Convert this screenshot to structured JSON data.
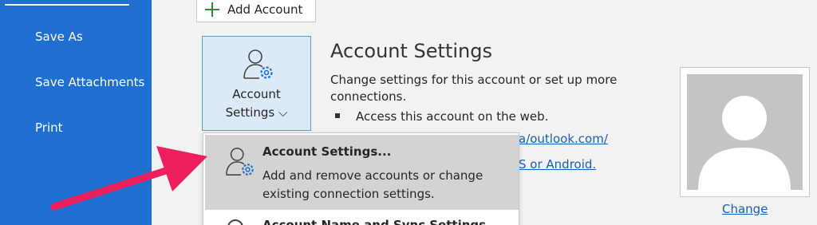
{
  "sidebar": {
    "items": [
      {
        "label": "Save As"
      },
      {
        "label": "Save Attachments"
      },
      {
        "label": "Print"
      }
    ]
  },
  "toolbar": {
    "add_account_label": "Add Account"
  },
  "account_settings_button": {
    "line1": "Account",
    "line2": "Settings ⌵"
  },
  "account_settings": {
    "heading": "Account Settings",
    "description": "Change settings for this account or set up more connections.",
    "bullet": "Access this account on the web.",
    "link1": "a/outlook.com/",
    "link2": "S or Android."
  },
  "profile": {
    "change_label": "Change"
  },
  "dropdown": {
    "item1": {
      "title": "Account Settings...",
      "desc_line1": "Add and remove accounts or change",
      "desc_line2": "existing connection settings."
    },
    "item2": {
      "title": "Account Name and Sync Settings"
    }
  },
  "colors": {
    "sidebar": "#1e6fd0",
    "accent": "#5b9bd5",
    "arrow": "#ef1f5e",
    "link": "#1a5fb4"
  },
  "icons": [
    "plus-icon",
    "account-settings-icon",
    "person-gear-icon",
    "avatar-placeholder-icon",
    "circle-icon",
    "annotation-arrow"
  ]
}
